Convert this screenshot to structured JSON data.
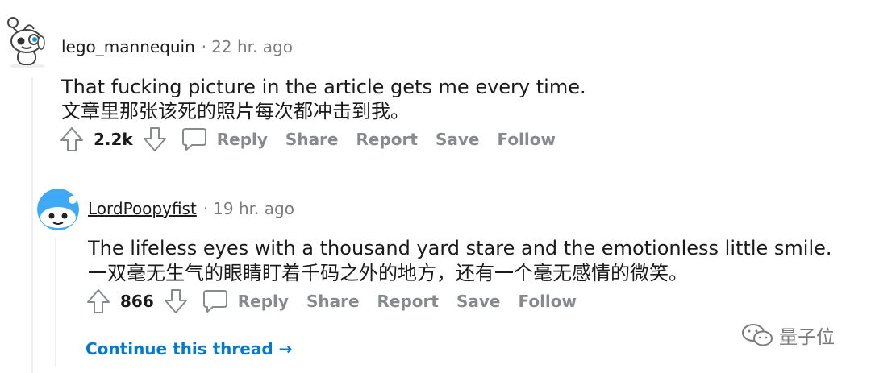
{
  "colors": {
    "accent": "#0079d3",
    "action_gray": "#878a8c",
    "meta_gray": "#7c7c7c",
    "thread_line": "#edeff1",
    "text": "#1a1a1b"
  },
  "comments": [
    {
      "username": "lego_mannequin",
      "separator": "·",
      "time": "22 hr. ago",
      "body_en": "That fucking picture in the article gets me every time.",
      "body_zh": "文章里那张该死的照片每次都冲击到我。",
      "score": "2.2k",
      "avatar_icon": "snoo-avatar-icon",
      "actions": {
        "reply": "Reply",
        "share": "Share",
        "report": "Report",
        "save": "Save",
        "follow": "Follow"
      }
    },
    {
      "username": "LordPoopyfist",
      "separator": "·",
      "time": "19 hr. ago",
      "body_en": "The lifeless eyes with a thousand yard stare and the emotionless little smile.",
      "body_zh": "一双毫无生气的眼睛盯着千码之外的地方，还有一个毫无感情的微笑。",
      "score": "866",
      "avatar_icon": "snoo-avatar-icon",
      "actions": {
        "reply": "Reply",
        "share": "Share",
        "report": "Report",
        "save": "Save",
        "follow": "Follow"
      }
    }
  ],
  "continue_thread": {
    "label": "Continue this thread",
    "arrow": "→"
  },
  "watermark": {
    "text": "量子位",
    "icon": "wechat-icon"
  }
}
